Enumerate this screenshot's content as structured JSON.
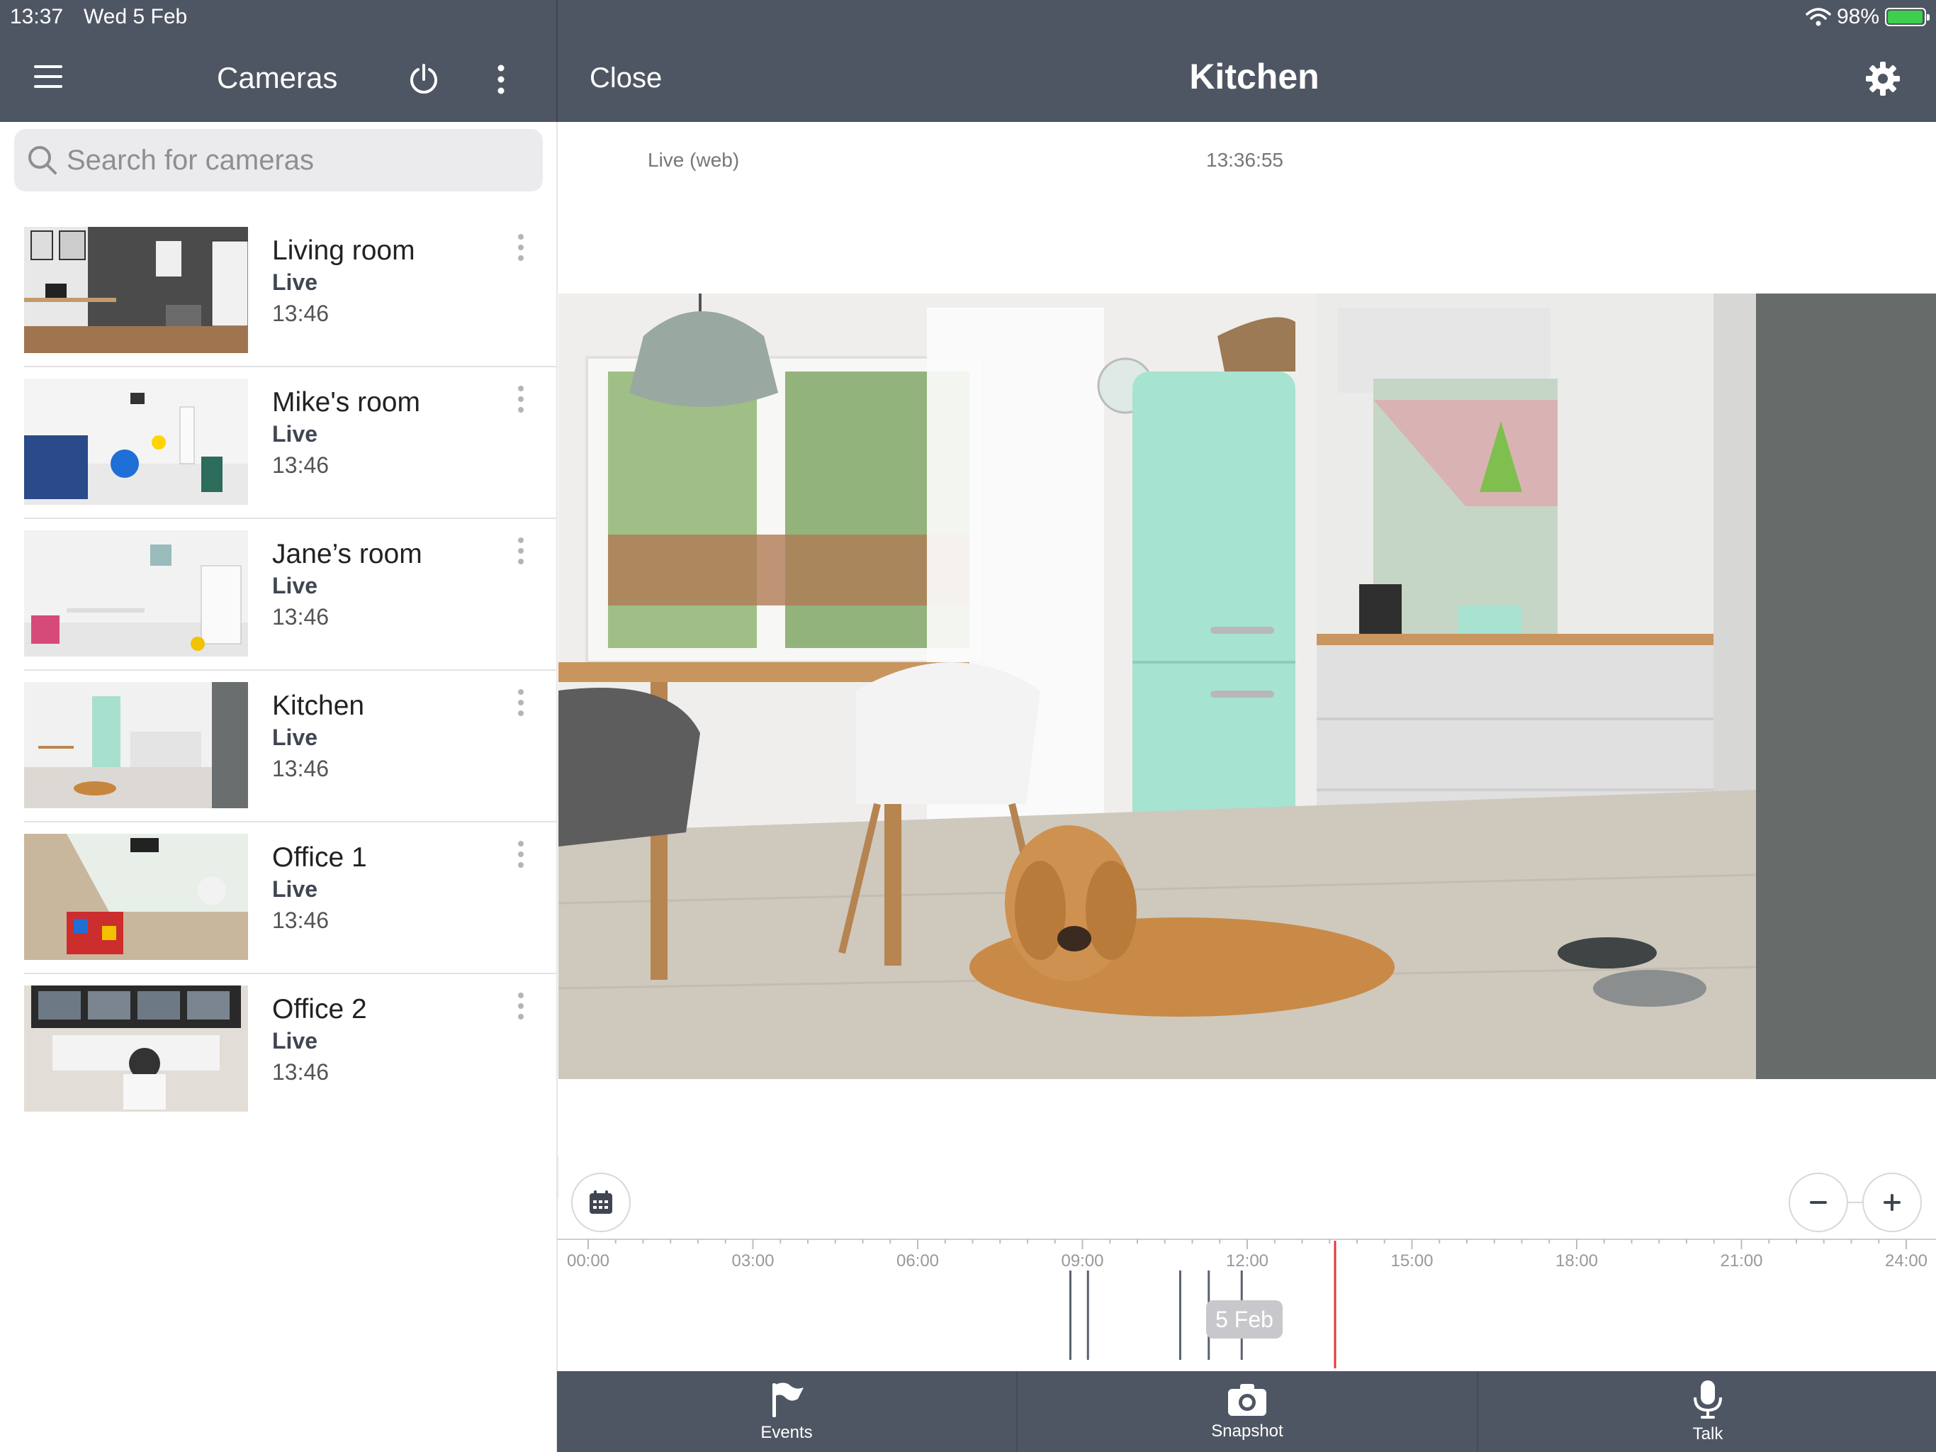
{
  "status_bar": {
    "time": "13:37",
    "date": "Wed 5 Feb",
    "battery": "98%",
    "battery_level": 0.98
  },
  "left_header": {
    "title": "Cameras"
  },
  "right_header": {
    "close_label": "Close",
    "title": "Kitchen"
  },
  "search": {
    "placeholder": "Search for cameras",
    "value": ""
  },
  "cameras": [
    {
      "name": "Living room",
      "status": "Live",
      "time": "13:46"
    },
    {
      "name": "Mike's room",
      "status": "Live",
      "time": "13:46"
    },
    {
      "name": "Jane’s room",
      "status": "Live",
      "time": "13:46"
    },
    {
      "name": "Kitchen",
      "status": "Live",
      "time": "13:46"
    },
    {
      "name": "Office 1",
      "status": "Live",
      "time": "13:46"
    },
    {
      "name": "Office 2",
      "status": "Live",
      "time": "13:46"
    }
  ],
  "player": {
    "mode": "Live (web)",
    "time": "13:36:55"
  },
  "timeline": {
    "labels": [
      "00:00",
      "03:00",
      "06:00",
      "09:00",
      "12:00",
      "15:00",
      "18:00",
      "21:00",
      "24:00"
    ],
    "date_badge": "5 Feb",
    "current_hour": 13.6,
    "event_hours": [
      8.78,
      9.1,
      10.78,
      11.3,
      11.9
    ],
    "playhead_color": "#e53935"
  },
  "toolbar": {
    "events_label": "Events",
    "snapshot_label": "Snapshot",
    "talk_label": "Talk"
  },
  "colors": {
    "header": "#4f5663",
    "accent": "#3f4652"
  }
}
